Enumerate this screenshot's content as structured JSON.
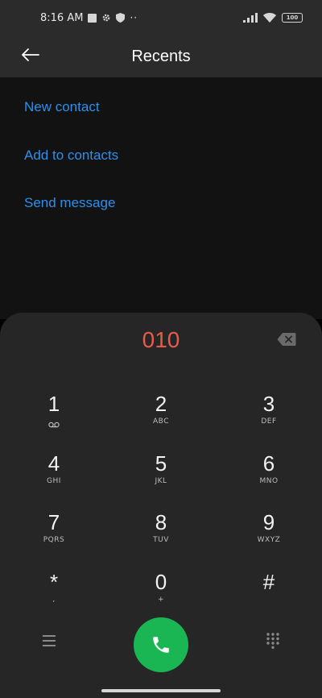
{
  "status_bar": {
    "time": "8:16 AM",
    "more": "··",
    "battery": "100"
  },
  "header": {
    "title": "Recents"
  },
  "actions": [
    "New contact",
    "Add to contacts",
    "Send message"
  ],
  "dialer": {
    "number": "010",
    "keys": [
      {
        "digit": "1",
        "letters": ""
      },
      {
        "digit": "2",
        "letters": "ABC"
      },
      {
        "digit": "3",
        "letters": "DEF"
      },
      {
        "digit": "4",
        "letters": "GHI"
      },
      {
        "digit": "5",
        "letters": "JKL"
      },
      {
        "digit": "6",
        "letters": "MNO"
      },
      {
        "digit": "7",
        "letters": "PQRS"
      },
      {
        "digit": "8",
        "letters": "TUV"
      },
      {
        "digit": "9",
        "letters": "WXYZ"
      },
      {
        "digit": "*",
        "letters": ","
      },
      {
        "digit": "0",
        "letters": "+"
      },
      {
        "digit": "#",
        "letters": ""
      }
    ]
  },
  "colors": {
    "accent": "#2f8fe8",
    "number": "#ea5a4c",
    "call": "#1ab653"
  },
  "icons": {
    "back": "arrow-left-icon",
    "backspace": "backspace-icon",
    "voicemail": "voicemail-icon",
    "menu": "menu-icon",
    "keypad": "dialpad-icon",
    "call": "phone-icon"
  }
}
